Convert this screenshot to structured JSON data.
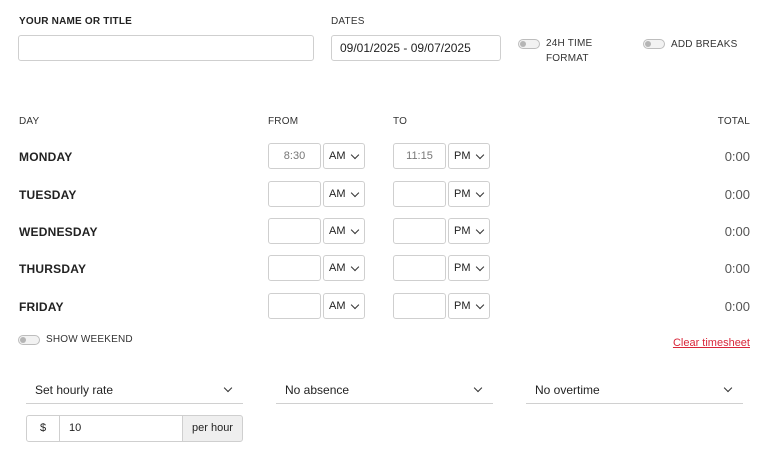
{
  "header": {
    "name_label": "YOUR NAME OR TITLE",
    "name_value": "",
    "dates_label": "DATES",
    "dates_value": "09/01/2025 - 09/07/2025",
    "toggle_24h_line1": "24H TIME",
    "toggle_24h_line2": "FORMAT",
    "toggle_breaks": "ADD BREAKS"
  },
  "columns": {
    "day": "DAY",
    "from": "FROM",
    "to": "TO",
    "total": "TOTAL"
  },
  "days": [
    {
      "name": "MONDAY",
      "from": "8:30",
      "from_ampm": "AM",
      "to": "11:15",
      "to_ampm": "PM",
      "total": "0:00"
    },
    {
      "name": "TUESDAY",
      "from": "",
      "from_ampm": "AM",
      "to": "",
      "to_ampm": "PM",
      "total": "0:00"
    },
    {
      "name": "WEDNESDAY",
      "from": "",
      "from_ampm": "AM",
      "to": "",
      "to_ampm": "PM",
      "total": "0:00"
    },
    {
      "name": "THURSDAY",
      "from": "",
      "from_ampm": "AM",
      "to": "",
      "to_ampm": "PM",
      "total": "0:00"
    },
    {
      "name": "FRIDAY",
      "from": "",
      "from_ampm": "AM",
      "to": "",
      "to_ampm": "PM",
      "total": "0:00"
    }
  ],
  "show_weekend": "SHOW WEEKEND",
  "clear_timesheet": "Clear timesheet",
  "dropdowns": {
    "rate": "Set hourly rate",
    "absence": "No absence",
    "overtime": "No overtime"
  },
  "rate": {
    "prefix": "$",
    "value": "10",
    "suffix": "per hour"
  },
  "colors": {
    "accent_red": "#d9263a",
    "border": "#cfcfcf"
  },
  "icons": {
    "toggle": "toggle-switch-icon",
    "dropdown": "chevron-down-icon"
  }
}
